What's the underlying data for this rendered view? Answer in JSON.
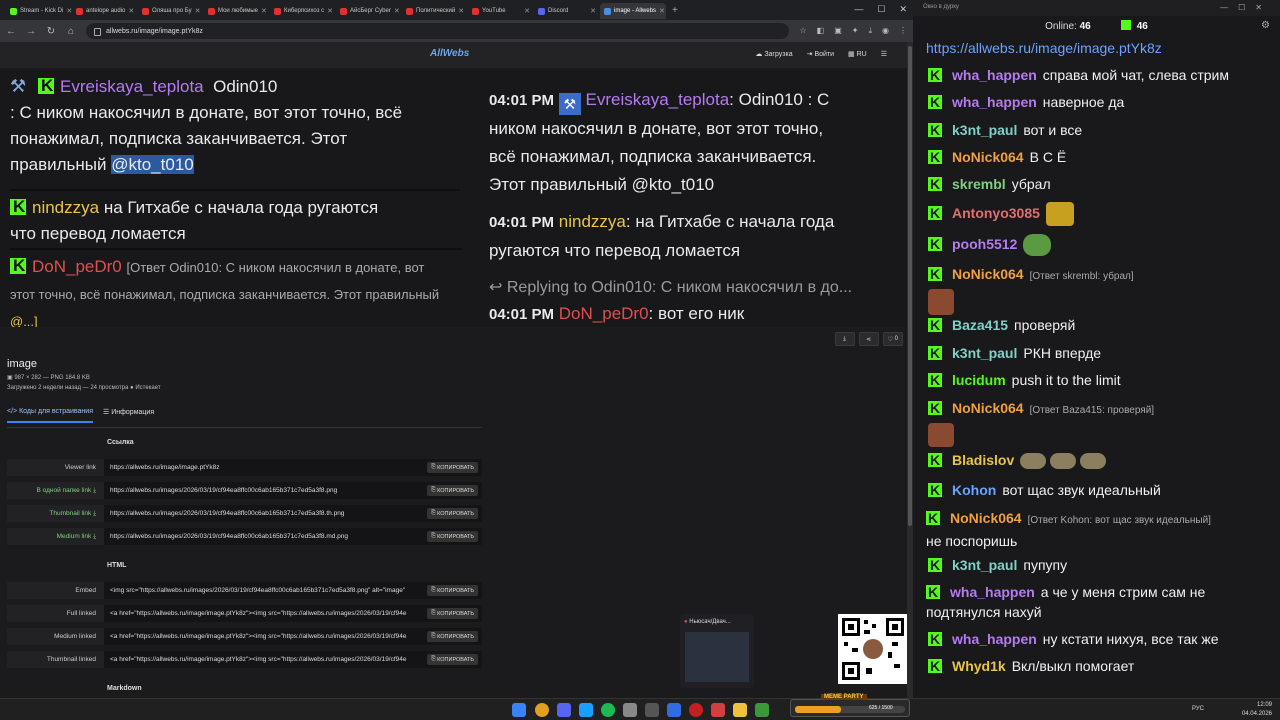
{
  "browser": {
    "tabs": [
      {
        "title": "Stream - Kick Di",
        "color": "#53fc18"
      },
      {
        "title": "antelope audio",
        "color": "#e03030"
      },
      {
        "title": "Оляша про Бу",
        "color": "#e03030"
      },
      {
        "title": "Мои любимые",
        "color": "#e03030"
      },
      {
        "title": "Киберпсихоз с",
        "color": "#e03030"
      },
      {
        "title": "АйсБерг Cyber",
        "color": "#e03030"
      },
      {
        "title": "Политический",
        "color": "#e03030"
      },
      {
        "title": "YouTube",
        "color": "#e03030"
      },
      {
        "title": "Discord",
        "color": "#5865f2"
      },
      {
        "title": "image - Allwebs",
        "color": "#4a90e2"
      }
    ],
    "url": "allwebs.ru/image/image.ptYk8z"
  },
  "site": {
    "logo": "AllWebs",
    "upload": "Загрузка",
    "login": "Войти",
    "lang": "RU",
    "like_count": "0"
  },
  "screenshot": {
    "left": {
      "msg1_name": "Evreiskaya_teplota",
      "msg1_reply_to": "Odin010",
      "msg1_text_a": ": С ником накосячил в донате, вот этот точно, всё",
      "msg1_text_b": "понажимал, подписка заканчивается. Этот",
      "msg1_text_c": "правильный ",
      "msg1_mention": "@kto_t010",
      "msg2_name": "nindzzya",
      "msg2_text_a": "на Гитхабе с начала года ругаются",
      "msg2_text_b": "что перевод ломается",
      "msg3_name": "DoN_peDr0",
      "msg3_reply_a": "[Ответ Odin010: С ником накосячил в донате, вот",
      "msg3_reply_b": "этот точно, всё понажимал, подписка заканчивается. Этот правильный",
      "msg3_reply_c": "@...]"
    },
    "right": {
      "time": "04:01 PM",
      "msg1_name": "Evreiskaya_teplota",
      "msg1_text_a": ": Odin010 : С",
      "msg1_text_b": "ником накосячил в донате, вот этот точно,",
      "msg1_text_c": "всё понажимал, подписка заканчивается.",
      "msg1_text_d": "Этот правильный @kto_t010",
      "msg2_name": "nindzzya",
      "msg2_text_a": ": на Гитхабе с начала года",
      "msg2_text_b": "ругаются что перевод ломается",
      "reply_line": "Replying to Odin010: С ником накосячил в до...",
      "msg3_name": "DoN_peDr0",
      "msg3_text": ": вот его ник"
    }
  },
  "meta": {
    "title": "image",
    "size": "987 × 282 — PNG 184.8 KB",
    "uploaded": "Загружено 2 недели назад — 24 просмотра",
    "expires": "Истекает"
  },
  "tabs2": {
    "embed": "Коды для встраивания",
    "info": "Информация"
  },
  "sections": {
    "link": "Ссылка",
    "html": "HTML",
    "markdown": "Markdown"
  },
  "copy_label": "КОПИРОВАТЬ",
  "link_rows": [
    {
      "label": "Viewer link",
      "value": "https://allwebs.ru/image/image.ptYk8z"
    },
    {
      "label": "В одной папке link",
      "value": "https://allwebs.ru/images/2026/03/19/cf94ea8ffc00c6ab165b371c7ed5a3f8.png"
    },
    {
      "label": "Thumbnail link",
      "value": "https://allwebs.ru/images/2026/03/19/cf94ea8ffc00c6ab165b371c7ed5a3f8.th.png"
    },
    {
      "label": "Medium link",
      "value": "https://allwebs.ru/images/2026/03/19/cf94ea8ffc00c6ab165b371c7ed5a3f8.md.png"
    }
  ],
  "html_rows": [
    {
      "label": "Embed",
      "value": "<img src=\"https://allwebs.ru/images/2026/03/19/cf94ea8ffc00c6ab165b371c7ed5a3f8.png\" alt=\"image\""
    },
    {
      "label": "Full linked",
      "value": "<a href=\"https://allwebs.ru/image/image.ptYk8z\"><img src=\"https://allwebs.ru/images/2026/03/19/cf94e"
    },
    {
      "label": "Medium linked",
      "value": "<a href=\"https://allwebs.ru/image/image.ptYk8z\"><img src=\"https://allwebs.ru/images/2026/03/19/cf94e"
    },
    {
      "label": "Thumbnail linked",
      "value": "<a href=\"https://allwebs.ru/image/image.ptYk8z\"><img src=\"https://allwebs.ru/images/2026/03/19/cf94e"
    }
  ],
  "popup": {
    "title": "Ньюсач/Двач..."
  },
  "chat": {
    "header": "Окно в дурку",
    "online_label": "Online:",
    "online": "46",
    "kick_count": "46",
    "link": "https://allwebs.ru/image/image.ptYk8z",
    "messages": [
      {
        "user": "wha_happen",
        "color": "#b57bf0",
        "text": "справа мой чат, слева стрим"
      },
      {
        "user": "wha_happen",
        "color": "#b57bf0",
        "text": "наверное да"
      },
      {
        "user": "k3nt_paul",
        "color": "#7fd1c7",
        "text": "вот и все"
      },
      {
        "user": "NoNick064",
        "color": "#f0a040",
        "text": "В С Ё"
      },
      {
        "user": "skrembl",
        "color": "#7fd17f",
        "text": "убрал"
      },
      {
        "user": "Antonyo3085",
        "color": "#e07070",
        "text": ""
      },
      {
        "user": "pooh5512",
        "color": "#b57bf0",
        "text": ""
      },
      {
        "user": "NoNick064",
        "color": "#f0a040",
        "reply": "[Ответ skrembl: убрал]",
        "text": ""
      },
      {
        "user": "Baza415",
        "color": "#7fd1c7",
        "text": "проверяй"
      },
      {
        "user": "k3nt_paul",
        "color": "#7fd1c7",
        "text": "РКН вперде"
      },
      {
        "user": "lucidum",
        "color": "#53fc18",
        "text": "push it to the limit"
      },
      {
        "user": "NoNick064",
        "color": "#f0a040",
        "reply": "[Ответ Baza415: проверяй]",
        "text": ""
      },
      {
        "user": "Bladislov",
        "color": "#e8c547",
        "text": ""
      },
      {
        "user": "Kohon",
        "color": "#6aa3ff",
        "text": "вот щас звук идеальный"
      },
      {
        "user": "NoNick064",
        "color": "#f0a040",
        "reply": "[Ответ Kohon: вот щас звук идеальный]",
        "text": "не поспоришь"
      },
      {
        "user": "k3nt_paul",
        "color": "#7fd1c7",
        "text": "пупупу"
      },
      {
        "user": "wha_happen",
        "color": "#b57bf0",
        "text": "а че у меня стрим сам не подтянулся нахуй"
      },
      {
        "user": "wha_happen",
        "color": "#b57bf0",
        "text": "ну кстати нихуя, все так же"
      },
      {
        "user": "Whyd1k",
        "color": "#e8c547",
        "text": "Вкл/выкл помогает"
      }
    ]
  },
  "taskbar": {
    "lang": "РУС",
    "time": "12:09",
    "date": "04.04.2026",
    "meme_title": "MEME PARTY",
    "meme_value": "625 / 1500",
    "meme_progress": 0.42
  }
}
